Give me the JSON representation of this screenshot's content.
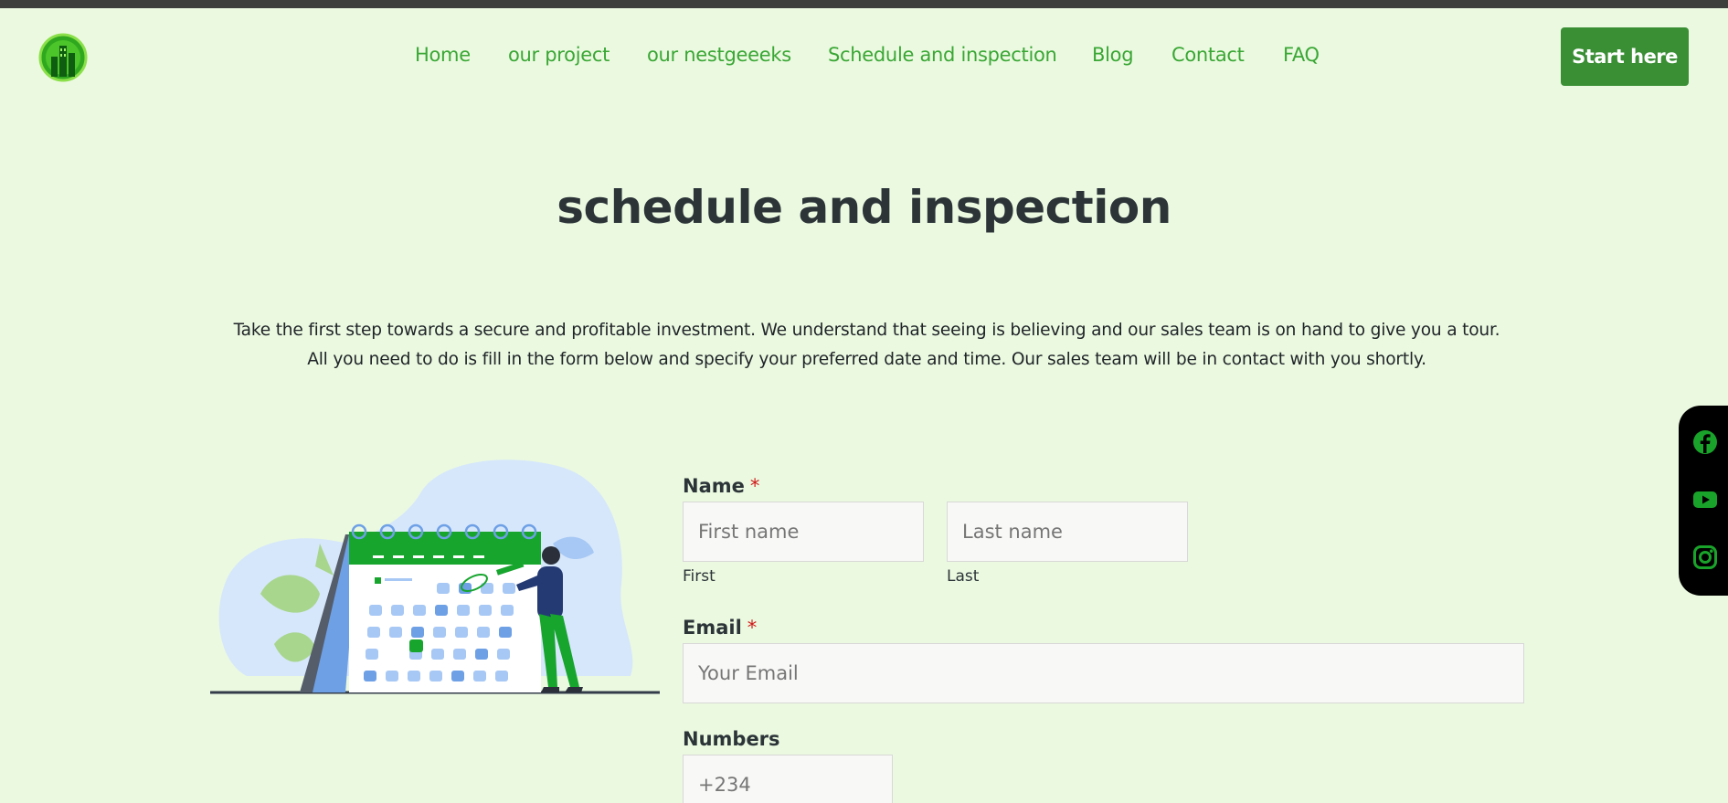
{
  "header": {
    "logo_icon": "building-chart-icon",
    "nav": [
      "Home",
      "our project",
      "our nestgeeeks",
      "Schedule and inspection",
      "Blog",
      "Contact",
      "FAQ"
    ],
    "cta_label": "Start here"
  },
  "main": {
    "title": "schedule and inspection",
    "intro_line1": "Take the first step towards a secure and profitable investment. We understand that seeing is believing and our sales team is on hand to give you a tour.",
    "intro_line2": "All you need to do is fill in the form below and specify your preferred date and time. Our sales team will be in contact with you shortly."
  },
  "form": {
    "name_label": "Name",
    "required_mark": "*",
    "first_placeholder": "First name",
    "last_placeholder": "Last name",
    "first_sublabel": "First",
    "last_sublabel": "Last",
    "email_label": "Email",
    "email_placeholder": "Your Email",
    "numbers_label": "Numbers",
    "numbers_placeholder": "+234"
  },
  "social": [
    "facebook-icon",
    "youtube-icon",
    "instagram-icon"
  ],
  "colors": {
    "background": "#ebf9e0",
    "accent": "#3aa735",
    "button": "#3a8f35",
    "heading": "#2c3438",
    "social_bg": "#000000",
    "social_icon": "#1aa32a"
  }
}
